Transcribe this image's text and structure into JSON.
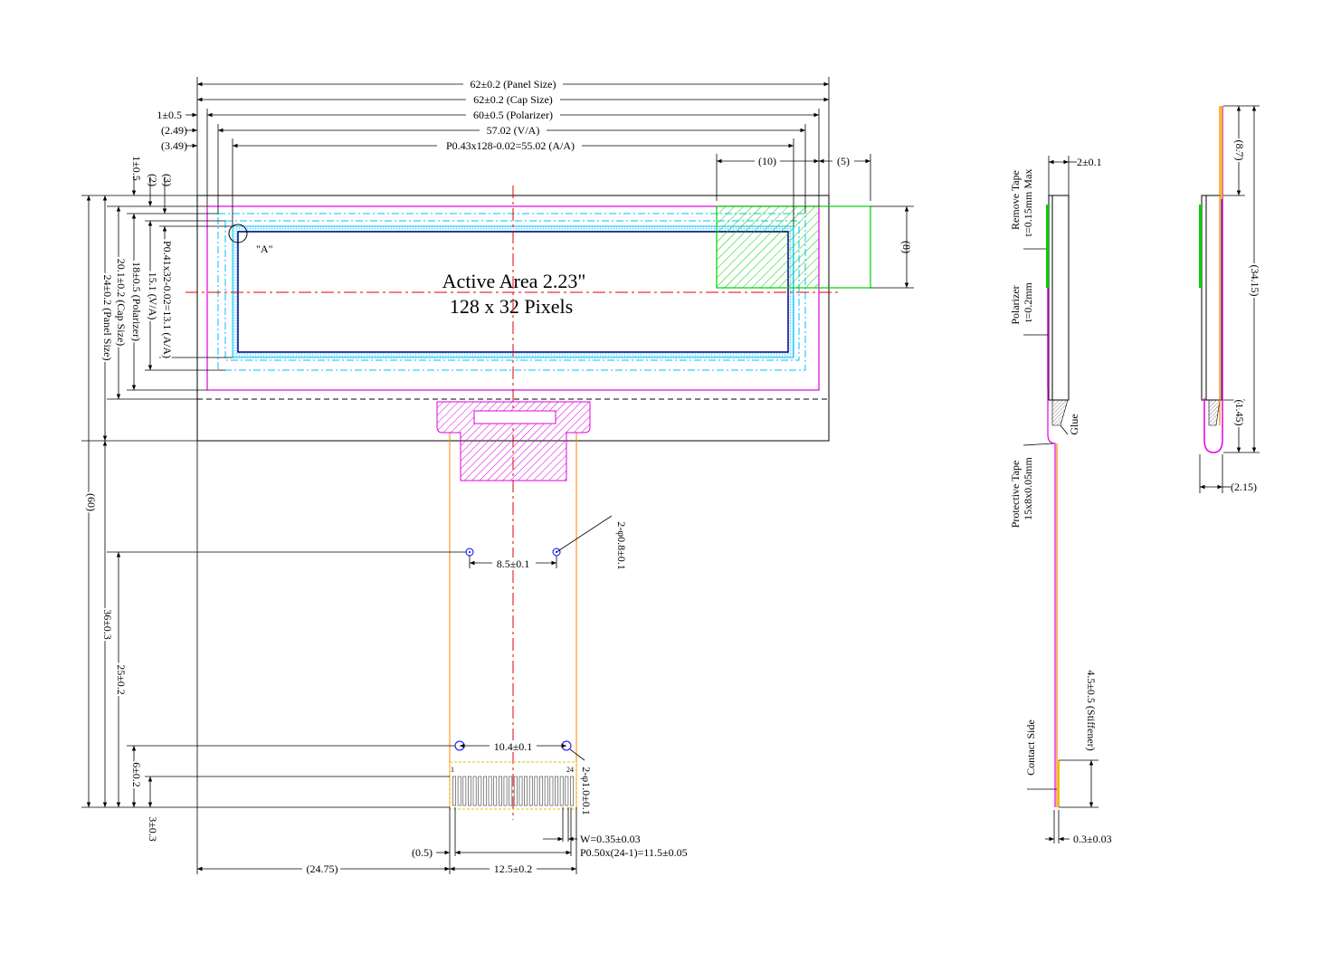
{
  "main_view": {
    "dims_top": {
      "panel_size": "62±0.2 (Panel Size)",
      "cap_size": "62±0.2 (Cap Size)",
      "polarizer": "60±0.5 (Polarizer)",
      "va": "57.02 (V/A)",
      "aa": "P0.43x128-0.02=55.02 (A/A)",
      "left_1": "1±0.5",
      "left_249": "(2.49)",
      "left_349": "(3.49)",
      "w10": "(10)",
      "w5": "(5)"
    },
    "dims_left": {
      "d1": "1±0.5",
      "d2": "(2)",
      "d3": "(3)",
      "aa_h": "P0.41x32-0.02=13.1 (A/A)",
      "va_h": "15.1 (V/A)",
      "pol_h": "18±0.5 (Polarizer)",
      "cap_h": "20.1±0.2 (Cap Size)",
      "panel_h": "24±0.2 (Panel Size)",
      "total_h": "(60)",
      "h36": "36±0.3",
      "h25": "25±0.2",
      "h6": "6±0.2",
      "h3": "3±0.3"
    },
    "dims_right": {
      "h8": "(8)"
    },
    "active_area_title": "Active Area 2.23\"",
    "pixels": "128 x 32 Pixels",
    "detail_a": "\"A\"",
    "fpc": {
      "hole_pitch_top": "8.5±0.1",
      "hole_dia_top": "2-φ0.8±0.1",
      "hole_pitch_bottom": "10.4±0.1",
      "hole_dia_bottom": "2-φ1.0±0.1",
      "pin_first": "1",
      "pin_last": "24",
      "lead_width": "W=0.35±0.03",
      "lead_pitch": "P0.50x(24-1)=11.5±0.05",
      "offset": "(0.5)",
      "left_offset": "(24.75)",
      "fpc_width": "12.5±0.2"
    }
  },
  "side_view": {
    "thickness": "2±0.1",
    "remove_tape": "Remove Tape",
    "remove_tape_t": "t=0.15mm Max",
    "polarizer": "Polarizer",
    "polarizer_t": "t=0.2mm",
    "glue": "Glue",
    "protective_tape": "Protective Tape",
    "protective_tape_size": "15x8x0.05mm",
    "stiffener": "4.5±0.5 (Stiffener)",
    "contact_side": "Contact Side",
    "fpc_thickness": "0.3±0.03"
  },
  "bent_view": {
    "d87": "(8.7)",
    "d3415": "(34.15)",
    "d145": "(1.45)",
    "d215": "(2.15)"
  },
  "colors": {
    "line": "#000000",
    "cyan": "#00c0ff",
    "magenta": "#e000e0",
    "green": "#00d000",
    "red": "#e00000",
    "orange": "#ff8000",
    "yellow": "#e8c000",
    "blue": "#0000ff"
  }
}
